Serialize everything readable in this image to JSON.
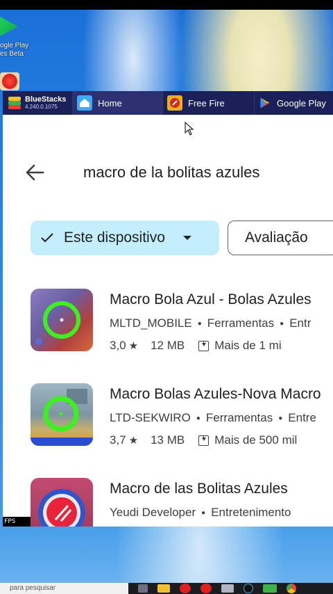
{
  "desktop": {
    "icon_label_line1": "ogle Play",
    "icon_label_line2": "es Beta"
  },
  "bluestacks": {
    "brand_name": "BlueStacks",
    "version": "4.240.0.1075",
    "tabs": [
      {
        "label": "Home",
        "icon": "home-icon"
      },
      {
        "label": "Free Fire",
        "icon": "free-fire-icon"
      },
      {
        "label": "Google Play",
        "icon": "google-play-icon"
      }
    ],
    "fps_label": "FPS"
  },
  "search": {
    "query": "macro de la bolitas azules"
  },
  "chips": {
    "device": "Este dispositivo",
    "rating": "Avaliação"
  },
  "apps": [
    {
      "title": "Macro Bola Azul - Bolas Azules",
      "developer": "MLTD_MOBILE",
      "category": "Ferramentas",
      "extra": "Entr",
      "rating": "3,0",
      "size": "12 MB",
      "downloads": "Mais de 1 mi"
    },
    {
      "title": "Macro Bolas Azules-Nova Macro",
      "developer": "LTD-SEKWIRO",
      "category": "Ferramentas",
      "extra": "Entre",
      "rating": "3,7",
      "size": "13 MB",
      "downloads": "Mais de 500 mil"
    },
    {
      "title": "Macro de las Bolitas Azules",
      "developer": "Yeudi Developer",
      "category": "Entretenimento"
    }
  ],
  "taskbar": {
    "search_placeholder": "para pesquisar"
  },
  "colors": {
    "chip_selected_bg": "#c5eefc",
    "bluestacks_tabbar": "#1a2058",
    "desktop_blue": "#1a6fd6"
  }
}
